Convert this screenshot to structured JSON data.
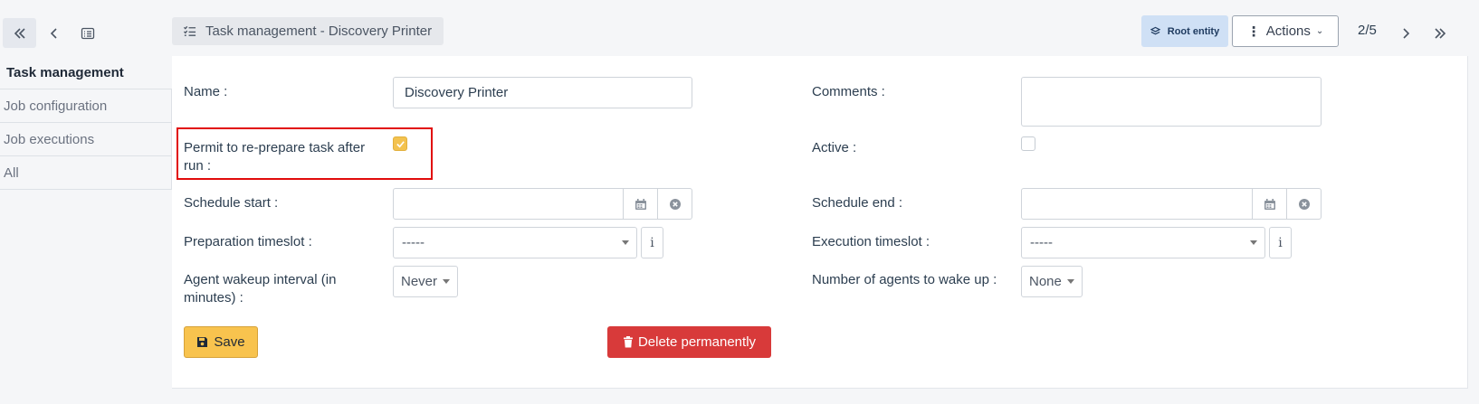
{
  "header": {
    "breadcrumb": "Task management - Discovery Printer",
    "root_entity_label": "Root entity",
    "actions_label": "Actions",
    "pager": "2/5"
  },
  "sidebar": {
    "items": [
      {
        "label": "Task management",
        "active": true
      },
      {
        "label": "Job configuration",
        "active": false
      },
      {
        "label": "Job executions",
        "active": false
      },
      {
        "label": "All",
        "active": false
      }
    ]
  },
  "form": {
    "name_label": "Name :",
    "name_value": "Discovery Printer",
    "comments_label": "Comments :",
    "comments_value": "",
    "reprepare_label_line1": "Permit to re-prepare task after",
    "reprepare_label_line2": "run :",
    "reprepare_checked": true,
    "active_label": "Active :",
    "active_checked": false,
    "schedule_start_label": "Schedule start :",
    "schedule_end_label": "Schedule end :",
    "prep_timeslot_label": "Preparation timeslot :",
    "prep_timeslot_value": "-----",
    "exec_timeslot_label": "Execution timeslot :",
    "exec_timeslot_value": "-----",
    "info_glyph": "i",
    "wakeup_label_line1": "Agent wakeup interval (in",
    "wakeup_label_line2": "minutes) :",
    "wakeup_value": "Never",
    "agents_label": "Number of agents to wake up :",
    "agents_value": "None",
    "save_label": "Save",
    "delete_label": "Delete permanently"
  },
  "colors": {
    "accent_yellow": "#f8c34e",
    "danger_red": "#d83a3a",
    "highlight_red": "#e10c0c",
    "root_badge_bg": "#cfe0f5"
  }
}
